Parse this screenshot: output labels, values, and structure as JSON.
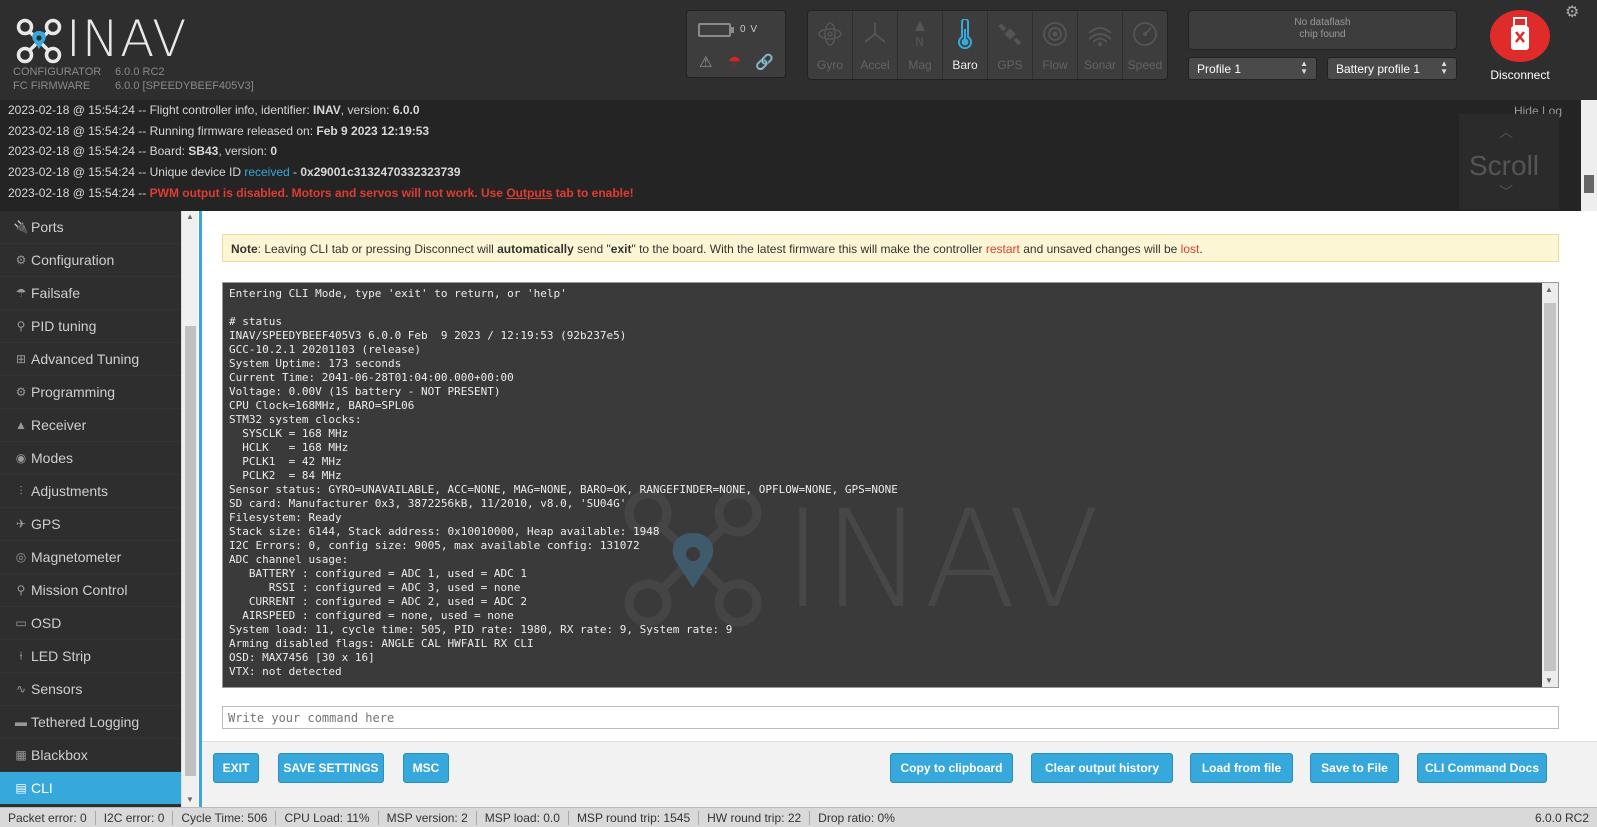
{
  "header": {
    "logo_text": "INAV",
    "configurator_label": "CONFIGURATOR",
    "configurator_version": "6.0.0 RC2",
    "firmware_label": "FC FIRMWARE",
    "firmware_version": "6.0.0 [SPEEDYBEEF405V3]",
    "battery_voltage": "0 V",
    "sensors": [
      {
        "label": "Gyro",
        "icon": "gyro-icon",
        "active": false
      },
      {
        "label": "Accel",
        "icon": "accel-icon",
        "active": false
      },
      {
        "label": "Mag",
        "icon": "mag-icon",
        "active": false
      },
      {
        "label": "Baro",
        "icon": "baro-icon",
        "active": true
      },
      {
        "label": "GPS",
        "icon": "gps-icon",
        "active": false
      },
      {
        "label": "Flow",
        "icon": "flow-icon",
        "active": false
      },
      {
        "label": "Sonar",
        "icon": "sonar-icon",
        "active": false
      },
      {
        "label": "Speed",
        "icon": "speed-icon",
        "active": false
      }
    ],
    "dataflash_line1": "No dataflash",
    "dataflash_line2": "chip found",
    "profile": "Profile 1",
    "battery_profile": "Battery profile 1",
    "disconnect_label": "Disconnect",
    "accent_color": "#37a8db",
    "disconnect_color": "#e02b2b"
  },
  "log": {
    "hide_label": "Hide Log",
    "scroll_label": "Scroll",
    "lines": [
      {
        "prefix": "2023-02-18 @ 15:54:24 -- Flight controller info, identifier: ",
        "b1": "INAV",
        "mid": ", version: ",
        "b2": "6.0.0"
      },
      {
        "prefix": "2023-02-18 @ 15:54:24 -- Running firmware released on: ",
        "b1": "Feb 9 2023 12:19:53"
      },
      {
        "prefix": "2023-02-18 @ 15:54:24 -- Board: ",
        "b1": "SB43",
        "mid": ", version: ",
        "b2": "0"
      },
      {
        "prefix": "2023-02-18 @ 15:54:24 -- Unique device ID ",
        "blue": "received",
        "mid": " - ",
        "b2": "0x29001c3132470332323739"
      },
      {
        "prefix": "2023-02-18 @ 15:54:24 -- ",
        "red1": "PWM output is disabled. Motors and servos will not work. Use ",
        "red_link": "Outputs",
        "red2": " tab to enable!"
      }
    ]
  },
  "sidebar": {
    "items": [
      {
        "label": "Ports",
        "icon": "plug-icon"
      },
      {
        "label": "Configuration",
        "icon": "gear-icon"
      },
      {
        "label": "Failsafe",
        "icon": "parachute-icon"
      },
      {
        "label": "PID tuning",
        "icon": "sitemap-icon"
      },
      {
        "label": "Advanced Tuning",
        "icon": "tree-icon"
      },
      {
        "label": "Programming",
        "icon": "cog-icon"
      },
      {
        "label": "Receiver",
        "icon": "receiver-icon"
      },
      {
        "label": "Modes",
        "icon": "toggle-icon"
      },
      {
        "label": "Adjustments",
        "icon": "sliders-icon"
      },
      {
        "label": "GPS",
        "icon": "satellite-icon"
      },
      {
        "label": "Magnetometer",
        "icon": "compass-icon"
      },
      {
        "label": "Mission Control",
        "icon": "map-marker-icon"
      },
      {
        "label": "OSD",
        "icon": "osd-icon"
      },
      {
        "label": "LED Strip",
        "icon": "led-icon"
      },
      {
        "label": "Sensors",
        "icon": "pulse-icon"
      },
      {
        "label": "Tethered Logging",
        "icon": "laptop-icon"
      },
      {
        "label": "Blackbox",
        "icon": "blackbox-icon"
      },
      {
        "label": "CLI",
        "icon": "terminal-icon"
      }
    ],
    "active": "CLI"
  },
  "note": {
    "bold_label": "Note",
    "t1": ": Leaving CLI tab or pressing Disconnect will ",
    "b1": "automatically",
    "t2": " send \"",
    "b2": "exit",
    "t3": "\" to the board. With the latest firmware this will make the controller ",
    "red1": "restart",
    "t4": " and unsaved changes will be ",
    "red2": "lost",
    "t5": "."
  },
  "console": {
    "lines": [
      "Entering CLI Mode, type 'exit' to return, or 'help'",
      "",
      "# status",
      "INAV/SPEEDYBEEF405V3 6.0.0 Feb  9 2023 / 12:19:53 (92b237e5)",
      "GCC-10.2.1 20201103 (release)",
      "System Uptime: 173 seconds",
      "Current Time: 2041-06-28T01:04:00.000+00:00",
      "Voltage: 0.00V (1S battery - NOT PRESENT)",
      "CPU Clock=168MHz, BARO=SPL06",
      "STM32 system clocks:",
      "  SYSCLK = 168 MHz",
      "  HCLK   = 168 MHz",
      "  PCLK1  = 42 MHz",
      "  PCLK2  = 84 MHz",
      "Sensor status: GYRO=UNAVAILABLE, ACC=NONE, MAG=NONE, BARO=OK, RANGEFINDER=NONE, OPFLOW=NONE, GPS=NONE",
      "SD card: Manufacturer 0x3, 3872256kB, 11/2010, v8.0, 'SU04G'",
      "Filesystem: Ready",
      "Stack size: 6144, Stack address: 0x10010000, Heap available: 1948",
      "I2C Errors: 0, config size: 9005, max available config: 131072",
      "ADC channel usage:",
      "   BATTERY : configured = ADC 1, used = ADC 1",
      "      RSSI : configured = ADC 3, used = none",
      "   CURRENT : configured = ADC 2, used = ADC 2",
      "  AIRSPEED : configured = none, used = none",
      "System load: 11, cycle time: 505, PID rate: 1980, RX rate: 9, System rate: 9",
      "Arming disabled flags: ANGLE CAL HWFAIL RX CLI",
      "OSD: MAX7456 [30 x 16]",
      "VTX: not detected"
    ],
    "watermark": "INAV",
    "input_placeholder": "Write your command here"
  },
  "buttons": {
    "exit": "EXIT",
    "save_settings": "SAVE SETTINGS",
    "msc": "MSC",
    "copy": "Copy to clipboard",
    "clear": "Clear output history",
    "load": "Load from file",
    "save_file": "Save to File",
    "docs": "CLI Command Docs"
  },
  "status_bar": {
    "packet_error": "Packet error: 0",
    "i2c_error": "I2C error: 0",
    "cycle_time": "Cycle Time: 506",
    "cpu_load": "CPU Load: 11%",
    "msp_version": "MSP version: 2",
    "msp_load": "MSP load: 0.0",
    "msp_round_trip": "MSP round trip: 1545",
    "hw_round_trip": "HW round trip: 22",
    "drop_ratio": "Drop ratio: 0%",
    "app_version": "6.0.0 RC2"
  }
}
